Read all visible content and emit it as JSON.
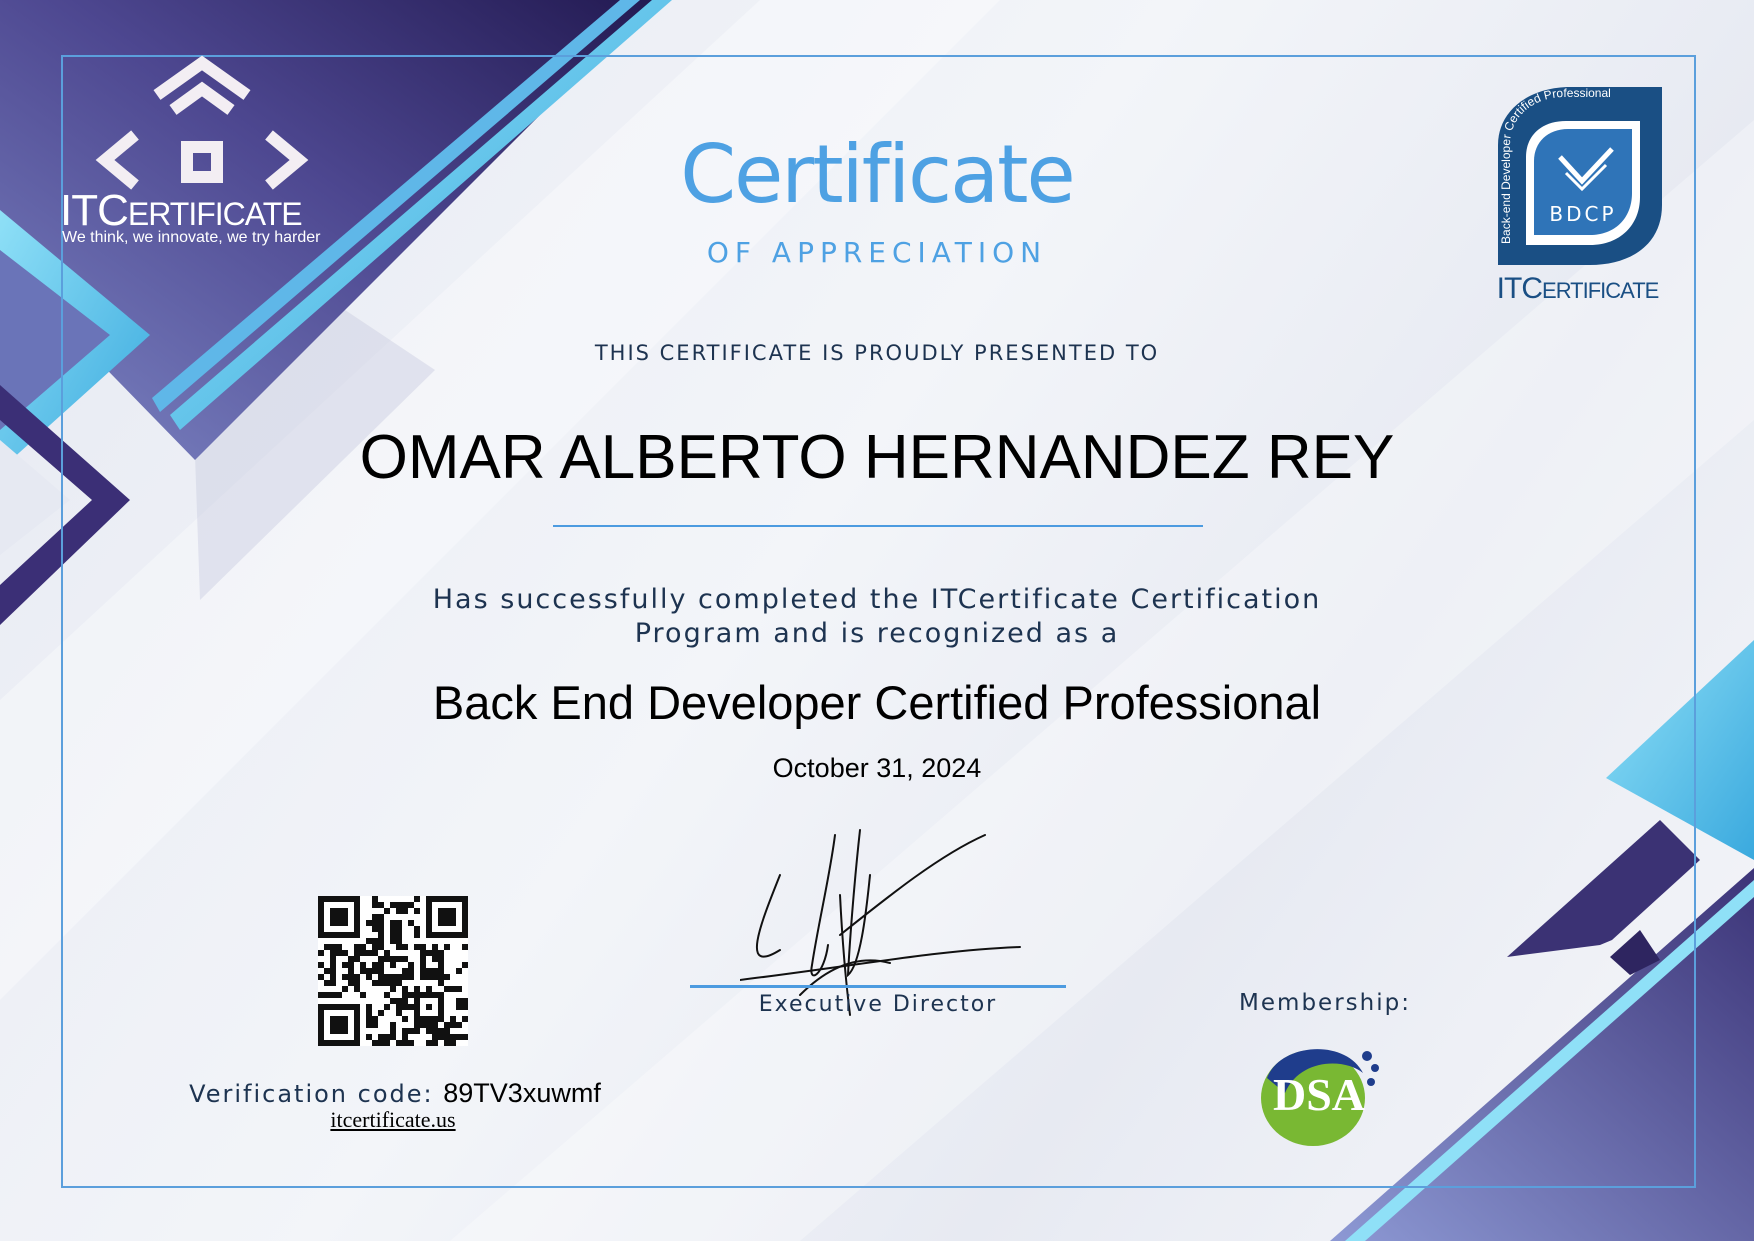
{
  "brand": {
    "prefix": "IT",
    "initial": "C",
    "rest": "ERTIFICATE",
    "tagline": "We think, we innovate, we try harder"
  },
  "heading": {
    "title": "Certificate",
    "subtitle": "OF APPRECIATION"
  },
  "presented_text": "THIS CERTIFICATE IS PROUDLY PRESENTED TO",
  "recipient_name": "OMAR ALBERTO HERNANDEZ REY",
  "statement": {
    "line1": "Has successfully completed the ITCertificate Certification",
    "line2": "Program and is recognized as a"
  },
  "certification_title": "Back End Developer Certified Professional",
  "issue_date": "October 31, 2024",
  "signature": {
    "role": "Executive Director"
  },
  "verification": {
    "label": "Verification code:",
    "code": "89TV3xuwmf",
    "website": "itcertificate.us"
  },
  "membership": {
    "label": "Membership:",
    "logo_letters": "DSA"
  },
  "badge": {
    "arc_text": "Back-end Developer Certified Professional",
    "acronym": "BDCP"
  },
  "colors": {
    "accent_blue": "#4ea1e3",
    "navy_text": "#1d3350",
    "deep_purple": "#2e2560",
    "light_cyan": "#7fd3f0"
  }
}
